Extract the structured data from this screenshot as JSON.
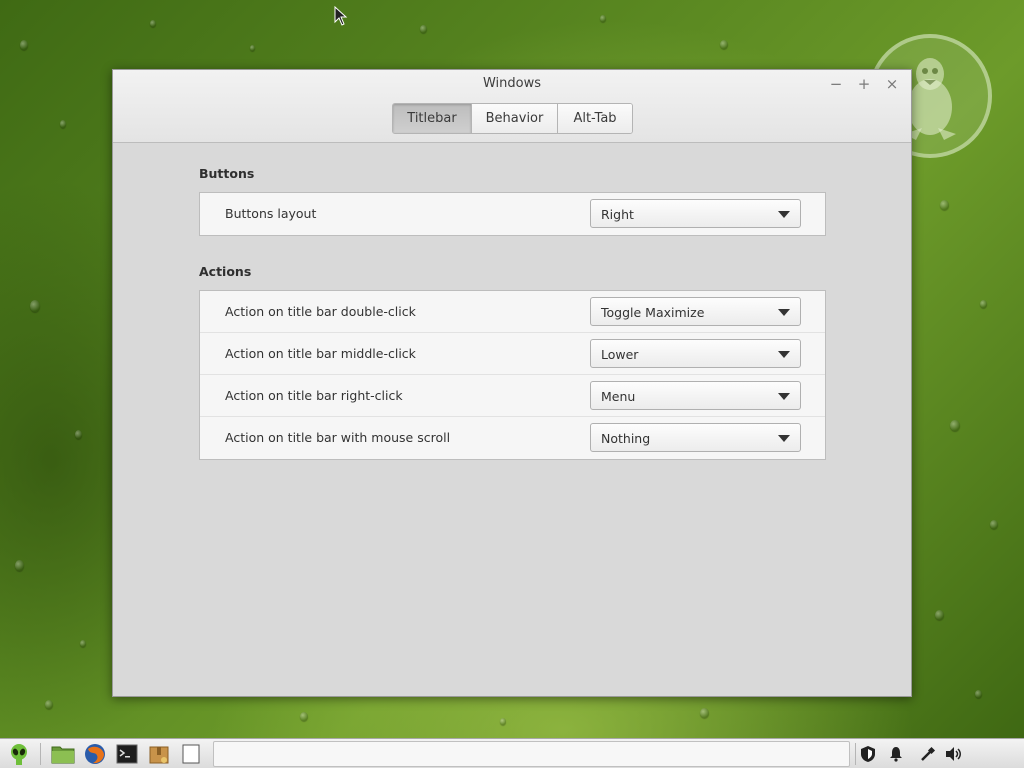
{
  "window": {
    "title": "Windows",
    "controls": {
      "minimize": "−",
      "maximize": "+",
      "close": "×"
    }
  },
  "tabs": [
    {
      "label": "Titlebar",
      "active": true
    },
    {
      "label": "Behavior",
      "active": false
    },
    {
      "label": "Alt-Tab",
      "active": false
    }
  ],
  "sections": {
    "buttons": {
      "title": "Buttons",
      "rows": [
        {
          "label": "Buttons layout",
          "value": "Right"
        }
      ]
    },
    "actions": {
      "title": "Actions",
      "rows": [
        {
          "label": "Action on title bar double-click",
          "value": "Toggle Maximize"
        },
        {
          "label": "Action on title bar middle-click",
          "value": "Lower"
        },
        {
          "label": "Action on title bar right-click",
          "value": "Menu"
        },
        {
          "label": "Action on title bar with mouse scroll",
          "value": "Nothing"
        }
      ]
    }
  },
  "taskbar": {
    "launchers": [
      "menu-alien-icon",
      "files-folder-icon",
      "firefox-icon",
      "terminal-icon",
      "archive-manager-icon",
      "text-editor-icon"
    ],
    "tray": [
      "shield-icon",
      "notification-bell-icon",
      "network-icon",
      "volume-icon"
    ]
  },
  "colors": {
    "window_bg": "#d9d9d9",
    "panel_bg": "#f6f6f6",
    "wallpaper_green": "#5c8a22"
  }
}
